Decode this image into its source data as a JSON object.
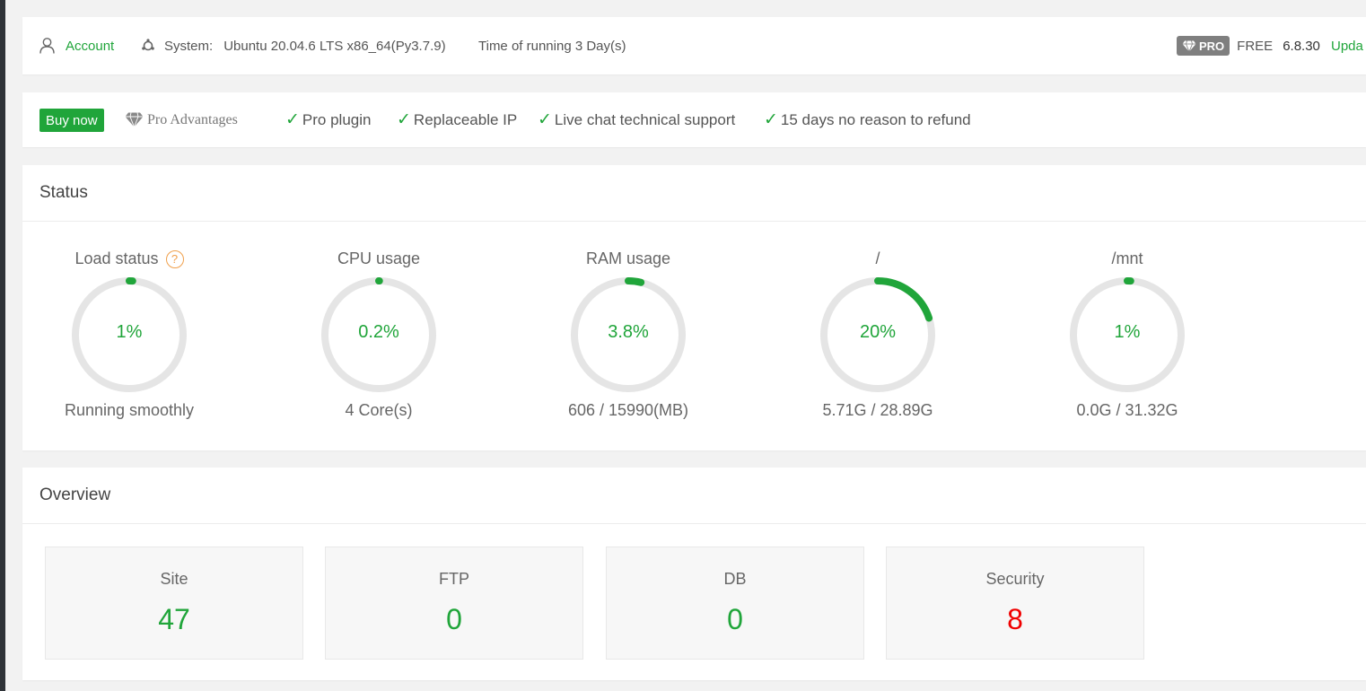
{
  "topbar": {
    "account_label": "Account",
    "system_label": "System:",
    "system_value": "Ubuntu 20.04.6 LTS x86_64(Py3.7.9)",
    "uptime": "Time of running 3 Day(s)",
    "pro_badge": "PRO",
    "edition": "FREE",
    "version": "6.8.30",
    "update_label": "Upda"
  },
  "promo": {
    "buy_label": "Buy now",
    "advantages_label": "Pro Advantages",
    "features": [
      "Pro plugin",
      "Replaceable IP",
      "Live chat technical support",
      "15 days no reason to refund"
    ]
  },
  "status": {
    "title": "Status",
    "gauges": [
      {
        "title": "Load status",
        "value": "1%",
        "sub": "Running smoothly",
        "percent": 1
      },
      {
        "title": "CPU usage",
        "value": "0.2%",
        "sub": "4 Core(s)",
        "percent": 0.2
      },
      {
        "title": "RAM usage",
        "value": "3.8%",
        "sub": "606 / 15990(MB)",
        "percent": 3.8
      },
      {
        "title": "/",
        "value": "20%",
        "sub": "5.71G / 28.89G",
        "percent": 20
      },
      {
        "title": "/mnt",
        "value": "1%",
        "sub": "0.0G / 31.32G",
        "percent": 1
      }
    ]
  },
  "overview": {
    "title": "Overview",
    "items": [
      {
        "label": "Site",
        "value": "47",
        "color": "#20a53a"
      },
      {
        "label": "FTP",
        "value": "0",
        "color": "#20a53a"
      },
      {
        "label": "DB",
        "value": "0",
        "color": "#20a53a"
      },
      {
        "label": "Security",
        "value": "8",
        "color": "#f00000"
      }
    ]
  },
  "colors": {
    "accent": "#20a53a",
    "track": "#e5e5e5",
    "warning": "#f0a04b"
  },
  "icons": {
    "account": "user-icon",
    "system": "ubuntu-icon",
    "pro": "diamond-icon",
    "check": "check-icon",
    "help": "question-icon"
  }
}
